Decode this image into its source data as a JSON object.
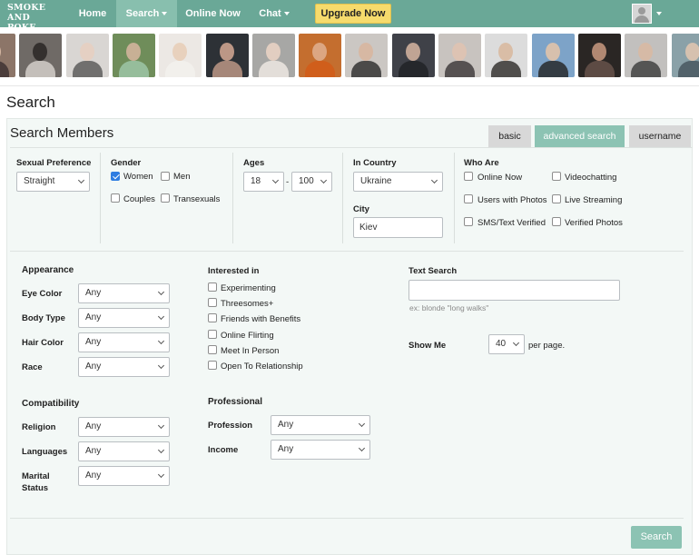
{
  "brand": {
    "line1": "SMOKE",
    "line2": "AND POKE"
  },
  "nav": {
    "home": "Home",
    "search": "Search",
    "online_now": "Online Now",
    "chat": "Chat",
    "upgrade": "Upgrade Now"
  },
  "photo_strip": [
    {
      "bg": "#8c7568",
      "face": "#e2c2ad",
      "torso": "#3b3030"
    },
    {
      "bg": "#6f6a66",
      "face": "#2a2624",
      "torso": "#d9d4d0"
    },
    {
      "bg": "#d9d6d3",
      "face": "#e6cfc0",
      "torso": "#555"
    },
    {
      "bg": "#6f8d5a",
      "face": "#d8b6a0",
      "torso": "#a0c9ab"
    },
    {
      "bg": "#ece8e4",
      "face": "#e8cdb6",
      "torso": "#f4f1ee"
    },
    {
      "bg": "#2d3136",
      "face": "#d6a994",
      "torso": "#c49d8b"
    },
    {
      "bg": "#a7a7a5",
      "face": "#ecd5c5",
      "torso": "#f2ece6"
    },
    {
      "bg": "#c46e2f",
      "face": "#e0b090",
      "torso": "#d35a17"
    },
    {
      "bg": "#cbc7c3",
      "face": "#d9b59d",
      "torso": "#2a2a2a"
    },
    {
      "bg": "#3f4148",
      "face": "#d7b6a2",
      "torso": "#1f2024"
    },
    {
      "bg": "#c8c3bf",
      "face": "#e0c3b0",
      "torso": "#3a3536"
    },
    {
      "bg": "#dcdcdc",
      "face": "#d8b79c",
      "torso": "#2d2a28"
    },
    {
      "bg": "#7da3c8",
      "face": "#e6c6a8",
      "torso": "#222"
    },
    {
      "bg": "#2a2624",
      "face": "#c99a80",
      "torso": "#6a554c"
    },
    {
      "bg": "#c2c0be",
      "face": "#d9b9a2",
      "torso": "#3a3a3a"
    },
    {
      "bg": "#8aa1a8",
      "face": "#e3c7b0",
      "torso": "#44525a"
    }
  ],
  "page_title": "Search",
  "panel_title": "Search Members",
  "tabs": {
    "basic": "basic",
    "advanced": "advanced search",
    "username": "username"
  },
  "basic": {
    "sexual_pref_label": "Sexual Preference",
    "sexual_pref_value": "Straight",
    "gender_label": "Gender",
    "gender": {
      "women": "Women",
      "men": "Men",
      "couples": "Couples",
      "transexuals": "Transexuals"
    },
    "gender_checked": {
      "women": true,
      "men": false,
      "couples": false,
      "transexuals": false
    },
    "ages_label": "Ages",
    "age_min": "18",
    "age_sep": "-",
    "age_max": "100",
    "country_label": "In Country",
    "country_value": "Ukraine",
    "city_label": "City",
    "city_value": "Kiev",
    "who_are_label": "Who Are",
    "who_are": {
      "online_now": "Online Now",
      "videochatting": "Videochatting",
      "users_with_photos": "Users with Photos",
      "live_streaming": "Live Streaming",
      "sms_text_verified": "SMS/Text Verified",
      "verified_photos": "Verified Photos"
    }
  },
  "appearance": {
    "heading": "Appearance",
    "eye_color": {
      "label": "Eye Color",
      "value": "Any"
    },
    "body_type": {
      "label": "Body Type",
      "value": "Any"
    },
    "hair_color": {
      "label": "Hair Color",
      "value": "Any"
    },
    "race": {
      "label": "Race",
      "value": "Any"
    }
  },
  "interested": {
    "heading": "Interested in",
    "experimenting": "Experimenting",
    "threesomes": "Threesomes+",
    "friends_with_benefits": "Friends with Benefits",
    "online_flirting": "Online Flirting",
    "meet_in_person": "Meet In Person",
    "open_to_relationship": "Open To Relationship"
  },
  "text_search": {
    "label": "Text Search",
    "value": "",
    "hint": "ex: blonde \"long walks\""
  },
  "show_me": {
    "label": "Show Me",
    "value": "40",
    "suffix": "per page."
  },
  "compatibility": {
    "heading": "Compatibility",
    "religion": {
      "label": "Religion",
      "value": "Any"
    },
    "languages": {
      "label": "Languages",
      "value": "Any"
    },
    "marital_line1": "Marital",
    "marital_line2": "Status",
    "marital_value": "Any"
  },
  "professional": {
    "heading": "Professional",
    "profession": {
      "label": "Profession",
      "value": "Any"
    },
    "income": {
      "label": "Income",
      "value": "Any"
    }
  },
  "search_button": "Search"
}
